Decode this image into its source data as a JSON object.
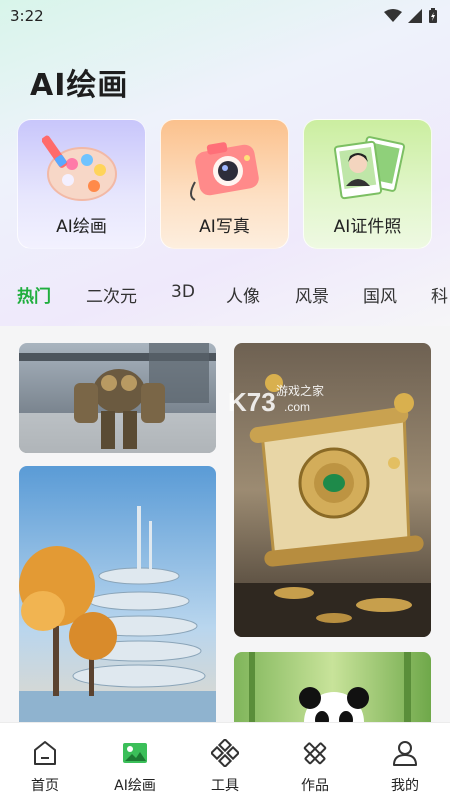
{
  "status_bar": {
    "time": "3:22"
  },
  "header": {
    "title": "AI绘画"
  },
  "features": [
    {
      "label": "AI绘画",
      "icon": "palette-icon"
    },
    {
      "label": "AI写真",
      "icon": "camera-icon"
    },
    {
      "label": "AI证件照",
      "icon": "id-photo-icon"
    }
  ],
  "tabs": [
    {
      "label": "热门",
      "active": true
    },
    {
      "label": "二次元"
    },
    {
      "label": "3D"
    },
    {
      "label": "人像"
    },
    {
      "label": "风景"
    },
    {
      "label": "国风"
    },
    {
      "label": "科"
    }
  ],
  "gallery": {
    "images": [
      "robot-image",
      "building-image",
      "scroll-coin-image",
      "panda-image"
    ]
  },
  "watermark": {
    "logo": "K73",
    "text": "游戏之家",
    "url": ".com"
  },
  "bottom_nav": [
    {
      "label": "首页",
      "icon": "home-icon"
    },
    {
      "label": "AI绘画",
      "icon": "ai-paint-icon",
      "active": true
    },
    {
      "label": "工具",
      "icon": "tools-icon"
    },
    {
      "label": "作品",
      "icon": "works-icon"
    },
    {
      "label": "我的",
      "icon": "profile-icon"
    }
  ],
  "colors": {
    "accent": "#1fae3d"
  }
}
